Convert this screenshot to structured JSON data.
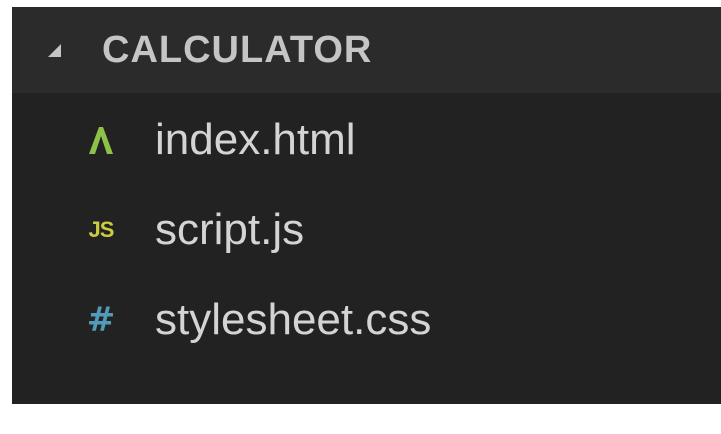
{
  "explorer": {
    "section_title": "CALCULATOR",
    "files": [
      {
        "name": "index.html",
        "icon": "html5-icon",
        "icon_color": "#8dc149"
      },
      {
        "name": "script.js",
        "icon": "javascript-icon",
        "icon_text": "JS",
        "icon_color": "#cbcb41"
      },
      {
        "name": "stylesheet.css",
        "icon": "css-hash-icon",
        "icon_text": "#",
        "icon_color": "#519aba"
      }
    ]
  },
  "colors": {
    "panel_background": "#222222",
    "header_background": "#2b2b2b",
    "text": "#d4d4d4"
  }
}
